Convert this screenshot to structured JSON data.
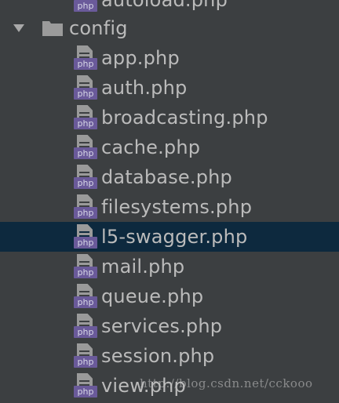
{
  "tree": {
    "partial_top_item": {
      "label": "autoload.php",
      "icon": "php-file-icon",
      "badge": "php"
    },
    "folder": {
      "label": "config",
      "expanded": true,
      "icon": "folder-icon"
    },
    "files": [
      {
        "label": "app.php",
        "badge": "php"
      },
      {
        "label": "auth.php",
        "badge": "php"
      },
      {
        "label": "broadcasting.php",
        "badge": "php"
      },
      {
        "label": "cache.php",
        "badge": "php"
      },
      {
        "label": "database.php",
        "badge": "php"
      },
      {
        "label": "filesystems.php",
        "badge": "php"
      },
      {
        "label": "l5-swagger.php",
        "badge": "php",
        "selected": true
      },
      {
        "label": "mail.php",
        "badge": "php"
      },
      {
        "label": "queue.php",
        "badge": "php"
      },
      {
        "label": "services.php",
        "badge": "php"
      },
      {
        "label": "session.php",
        "badge": "php"
      },
      {
        "label": "view.php",
        "badge": "php"
      }
    ]
  },
  "watermark": "http://blog.csdn.net/cckooo",
  "colors": {
    "background": "#3c3f41",
    "selection": "#0d293e",
    "text": "#bbbbbb",
    "php_badge": "#6a5a9a",
    "file_sheet": "#9a9a9a",
    "folder": "#9b9b9b"
  }
}
